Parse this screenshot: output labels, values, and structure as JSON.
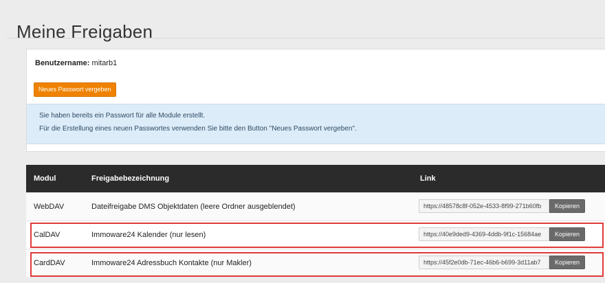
{
  "page": {
    "title": "Meine Freigaben"
  },
  "account": {
    "username_label": "Benutzername:",
    "username": "mitarb1",
    "new_password_button": "Neues Passwort vergeben"
  },
  "info": {
    "line1": "Sie haben bereits ein Passwort für alle Module erstellt.",
    "line2": "Für die Erstellung eines neuen Passwortes verwenden Sie bitte den Button \"Neues Passwort vergeben\"."
  },
  "table": {
    "headers": [
      "Modul",
      "Freigabebezeichnung",
      "Link"
    ],
    "rows": [
      {
        "module": "WebDAV",
        "label": "Dateifreigabe DMS Objektdaten (leere Ordner ausgeblendet)",
        "link": "https://48578c8f-052e-4533-8f99-271b60fb",
        "copy": "Kopieren"
      },
      {
        "module": "CalDAV",
        "label": "Immoware24 Kalender (nur lesen)",
        "link": "https://40e9ded9-4369-4ddb-9f1c-15684ae",
        "copy": "Kopieren"
      },
      {
        "module": "CardDAV",
        "label": "Immoware24 Adressbuch Kontakte (nur Makler)",
        "link": "https://45f2e0db-71ec-46b6-b699-3d11ab7",
        "copy": "Kopieren"
      }
    ]
  },
  "colors": {
    "accent_orange": "#ef8200",
    "table_header": "#2b2b2b",
    "info_background": "#dcecf8",
    "highlight_red": "#e03a3a"
  }
}
